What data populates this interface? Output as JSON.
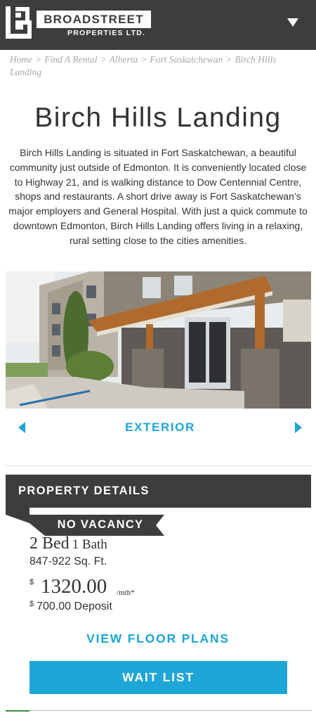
{
  "brand": {
    "name": "BROADSTREET",
    "subtitle": "PROPERTIES LTD.",
    "logo_icon": "bs-monogram-logo",
    "menu_icon": "chevron-down-icon"
  },
  "breadcrumb": {
    "items": [
      "Home",
      "Find A Rental",
      "Alberta",
      "Fort Saskatchewan",
      "Birch Hills Landing"
    ],
    "separator": ">"
  },
  "property": {
    "title": "Birch Hills Landing",
    "description": "Birch Hills Landing is situated in Fort Saskatchewan, a beautiful community just outside of Edmonton. It is conveniently located close to Highway 21, and is walking distance to Dow Centennial Centre, shops and restaurants. A short drive away is Fort Saskatchewan’s major employers and General Hospital. With just a quick commute to downtown Edmonton, Birch Hills Landing offers living in a relaxing, rural setting close to the cities amenities."
  },
  "gallery": {
    "caption": "EXTERIOR",
    "prev_icon": "caret-left-icon",
    "next_icon": "caret-right-icon"
  },
  "details": {
    "header": "PROPERTY DETAILS",
    "vacancy": "NO VACANCY",
    "beds_num": "2 Bed",
    "baths_num": "1 Bath",
    "sqft": "847-922 Sq. Ft.",
    "currency": "$",
    "price": "1320.00",
    "price_unit": "/mth*",
    "deposit": "700.00 Deposit",
    "floor_plans_label": "VIEW FLOOR PLANS",
    "wait_list_label": "WAIT LIST"
  },
  "colors": {
    "accent": "#1ea6d8",
    "header_bg": "#3d3d3f",
    "text": "#333333",
    "breadcrumb": "#a7a7a7"
  }
}
